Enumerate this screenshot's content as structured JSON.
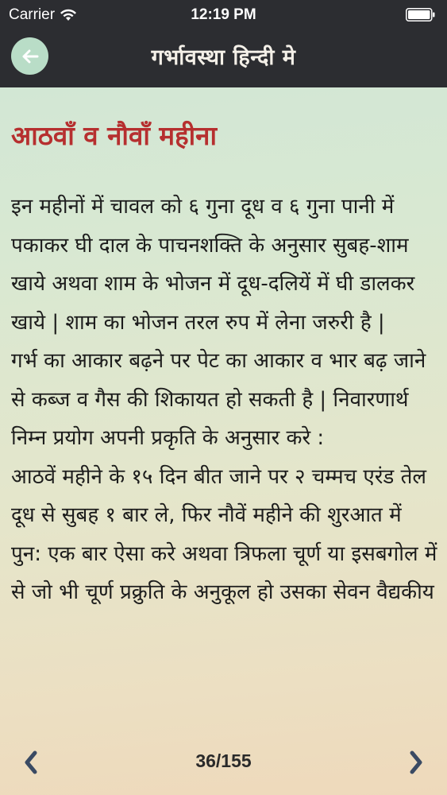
{
  "status_bar": {
    "carrier": "Carrier",
    "time": "12:19 PM",
    "icons": [
      "wifi-icon",
      "battery-icon"
    ]
  },
  "nav": {
    "title": "गर्भावस्था हिन्दी मे",
    "back_icon": "arrow-left-icon"
  },
  "chapter": {
    "title": "आठवाँ व नौवाँ महीना",
    "paragraphs": [
      "इन महीनों में चावल को ६ गुना दूध व ६ गुना पानी में पकाकर घी दाल के पाचनशक्ति के अनुसार सुबह-शाम खाये अथवा शाम के भोजन में दूध-दलियें में घी डालकर खाये | शाम का भोजन तरल रुप में लेना जरुरी है |",
      "गर्भ का आकार बढ़ने पर पेट का आकार व भार बढ़ जाने से कब्ज व गैस की शिकायत हो सकती है | निवारणार्थ निम्न प्रयोग अपनी प्रकृति के अनुसार करे :",
      "आठवें महीने के १५ दिन बीत जाने पर २ चम्मच एरंड तेल दूध से सुबह १ बार ले, फिर नौवें महीने की शुरआत में पुन: एक बार ऐसा करे अथवा त्रिफला चूर्ण या इसबगोल में से जो भी चूर्ण प्रक्रुति के अनुकूल हो उसका सेवन वैद्यकीय"
    ]
  },
  "pager": {
    "page_label": "36/155",
    "prev_icon": "chevron-left-icon",
    "next_icon": "chevron-right-icon"
  },
  "colors": {
    "nav_background": "#2c2d31",
    "title_red": "#b62f2f",
    "back_button_bg": "#b9ddc7"
  }
}
